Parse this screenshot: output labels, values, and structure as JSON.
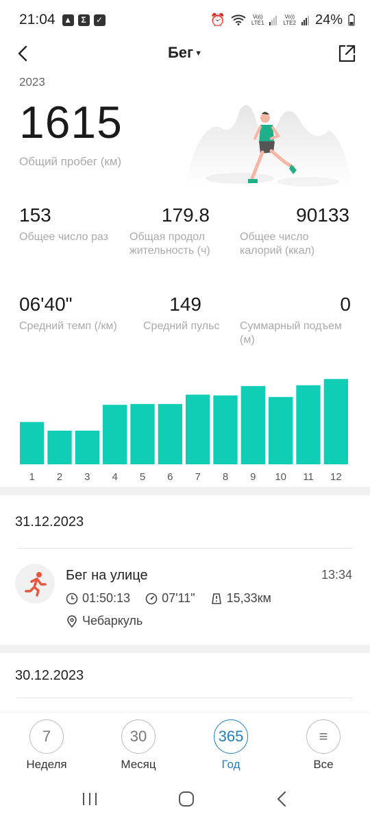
{
  "status_bar": {
    "time": "21:04",
    "battery": "24%",
    "sim1": "LTE1",
    "sim2": "LTE2",
    "volte": "Vo))"
  },
  "header": {
    "title": "Бег"
  },
  "summary": {
    "year": "2023",
    "total_distance": "1615",
    "total_distance_label": "Общий пробег (км)"
  },
  "stats": [
    {
      "value": "153",
      "label": "Общее число раз"
    },
    {
      "value": "179.8",
      "label": "Общая продол жительность (ч)"
    },
    {
      "value": "90133",
      "label": "Общее число калорий (ккал)"
    },
    {
      "value": "06'40\"",
      "label": "Средний темп (/км)"
    },
    {
      "value": "149",
      "label": "Средний пульс"
    },
    {
      "value": "0",
      "label": "Суммарный подъем (м)"
    }
  ],
  "chart_data": {
    "type": "bar",
    "categories": [
      "1",
      "2",
      "3",
      "4",
      "5",
      "6",
      "7",
      "8",
      "9",
      "10",
      "11",
      "12"
    ],
    "values": [
      54,
      43,
      43,
      76,
      77,
      77,
      89,
      88,
      100,
      86,
      101,
      109
    ],
    "ylim": [
      0,
      120
    ],
    "color": "#10cdb5",
    "grid": false
  },
  "activities": [
    {
      "date": "31.12.2023",
      "title": "Бег на улице",
      "time": "13:34",
      "duration": "01:50:13",
      "pace": "07'11\"",
      "distance": "15,33км",
      "location": "Чебаркуль"
    }
  ],
  "next_date": "30.12.2023",
  "bottom_nav": [
    {
      "icon_text": "7",
      "label": "Неделя",
      "active": false
    },
    {
      "icon_text": "30",
      "label": "Месяц",
      "active": false
    },
    {
      "icon_text": "365",
      "label": "Год",
      "active": true
    },
    {
      "icon_text": "≡",
      "label": "Все",
      "active": false
    }
  ],
  "colors": {
    "accent": "#10cdb5",
    "active_nav": "#1e7fbf",
    "runner": "#e8553e"
  }
}
